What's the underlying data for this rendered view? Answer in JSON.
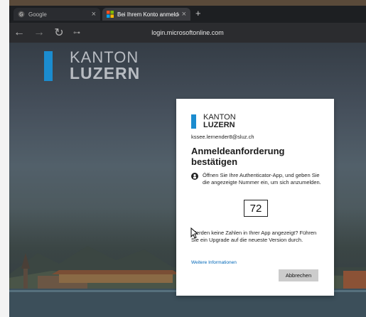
{
  "browser": {
    "tabs": [
      {
        "label": "Google",
        "active": false,
        "favicon": "google-favicon-icon"
      },
      {
        "label": "Bei Ihrem Konto anmelden",
        "active": true,
        "favicon": "microsoft-favicon-icon"
      }
    ],
    "tab_close_glyph": "×",
    "new_tab_glyph": "+",
    "url": "login.microsoftonline.com"
  },
  "background": {
    "brand_line1": "KANTON",
    "brand_line2": "LUZERN"
  },
  "card": {
    "logo_line1": "KANTON",
    "logo_line2": "LUZERN",
    "email": "kssee.lernender8@sluz.ch",
    "title": "Anmeldeanforderung bestätigen",
    "info": "Öffnen Sie Ihre Authenticator-App, und geben Sie die angezeigte Nummer ein, um sich anzumelden.",
    "number": "72",
    "no_numbers": "Werden keine Zahlen in Ihrer App angezeigt? Führen Sie ein Upgrade auf die neueste Version durch.",
    "more_info": "Weitere Informationen",
    "cancel_label": "Abbrechen"
  },
  "colors": {
    "brand_blue": "#1b8ccf",
    "link_blue": "#0067b8"
  }
}
